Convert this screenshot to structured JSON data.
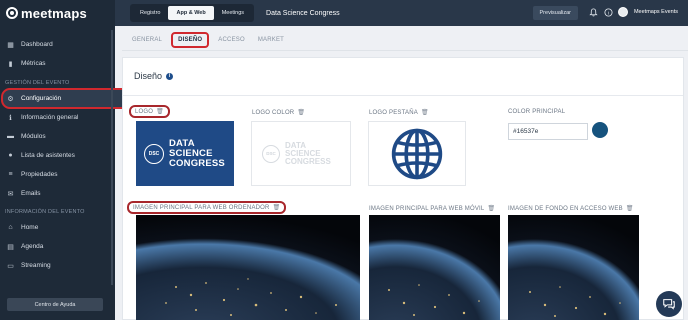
{
  "brand": {
    "name": "meetmaps"
  },
  "sidebar": {
    "items_top": [
      {
        "label": "Dashboard",
        "icon": "dashboard-icon"
      },
      {
        "label": "Métricas",
        "icon": "bar-chart-icon"
      }
    ],
    "section_event": "GESTIÓN DEL EVENTO",
    "items_event": [
      {
        "label": "Configuración",
        "icon": "gear-icon"
      },
      {
        "label": "Información general",
        "icon": "info-icon"
      },
      {
        "label": "Módulos",
        "icon": "modules-icon"
      },
      {
        "label": "Lista de asistentes",
        "icon": "users-icon"
      },
      {
        "label": "Propiedades",
        "icon": "properties-icon"
      },
      {
        "label": "Emails",
        "icon": "mail-icon"
      }
    ],
    "section_info": "INFORMACIÓN DEL EVENTO",
    "items_info": [
      {
        "label": "Home",
        "icon": "home-icon"
      },
      {
        "label": "Agenda",
        "icon": "calendar-icon"
      },
      {
        "label": "Streaming",
        "icon": "streaming-icon"
      }
    ],
    "help_label": "Centro de Ayuda"
  },
  "topbar": {
    "tabs": [
      {
        "label": "Registro"
      },
      {
        "label": "App & Web",
        "active": true
      },
      {
        "label": "Meetings"
      }
    ],
    "event_title": "Data Science Congress",
    "preview_label": "Previsualizar",
    "user_name": "Meetmaps Events"
  },
  "subtabs": [
    {
      "label": "GENERAL"
    },
    {
      "label": "DISEÑO",
      "active": true
    },
    {
      "label": "ACCESO"
    },
    {
      "label": "MARKET"
    }
  ],
  "panel": {
    "title": "Diseño",
    "labels": {
      "logo": "LOGO",
      "logo_color": "LOGO COLOR",
      "logo_tab": "LOGO PESTAÑA",
      "primary_color": "COLOR PRINCIPAL",
      "main_image_desktop": "IMAGEN PRINCIPAL PARA WEB ORDENADOR",
      "main_image_mobile": "IMAGEN PRINCIPAL PARA WEB MÓVIL",
      "background_image_access": "IMAGEN DE FONDO EN ACCESO WEB"
    },
    "logo_badge": "DSC",
    "logo_words": [
      "DATA",
      "SCIENCE",
      "CONGRESS"
    ],
    "primary_color_value": "#16537e"
  },
  "colors": {
    "sidebar_bg": "#1e2a38",
    "topbar_bg": "#293749",
    "brand_blue": "#1f4a86",
    "primary": "#16537e",
    "highlight_red": "#d0282e"
  }
}
